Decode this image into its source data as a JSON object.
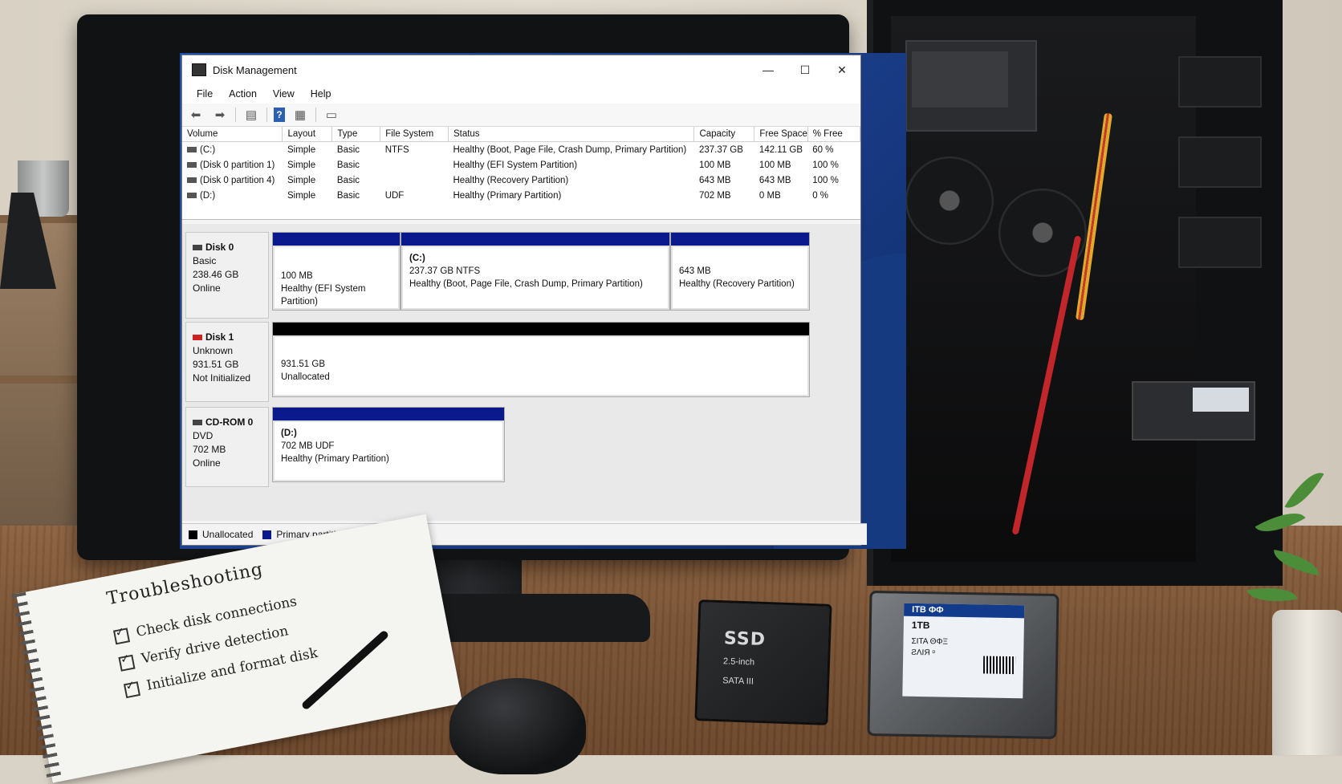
{
  "window": {
    "title": "Disk Management",
    "controls": {
      "minimize": "—",
      "maximize": "☐",
      "close": "✕"
    }
  },
  "menu": [
    "File",
    "Action",
    "View",
    "Help"
  ],
  "toolbar": {
    "back_icon": "back-arrow-icon",
    "forward_icon": "forward-arrow-icon",
    "help_label": "?"
  },
  "volume_table": {
    "columns": [
      "Volume",
      "Layout",
      "Type",
      "File System",
      "Status",
      "Capacity",
      "Free Space",
      "% Free"
    ],
    "rows": [
      [
        "(C:)",
        "Simple",
        "Basic",
        "NTFS",
        "Healthy (Boot, Page File, Crash Dump, Primary Partition)",
        "237.37 GB",
        "142.11 GB",
        "60 %"
      ],
      [
        "(Disk 0 partition 1)",
        "Simple",
        "Basic",
        "",
        "Healthy (EFI System Partition)",
        "100 MB",
        "100 MB",
        "100 %"
      ],
      [
        "(Disk 0 partition 4)",
        "Simple",
        "Basic",
        "",
        "Healthy (Recovery Partition)",
        "643 MB",
        "643 MB",
        "100 %"
      ],
      [
        "(D:)",
        "Simple",
        "Basic",
        "UDF",
        "Healthy (Primary Partition)",
        "702 MB",
        "0 MB",
        "0 %"
      ]
    ]
  },
  "disks": [
    {
      "name": "Disk 0",
      "type": "Basic",
      "size": "238.46 GB",
      "state": "Online",
      "partitions": [
        {
          "letter": "",
          "size": "100 MB",
          "status": "Healthy (EFI System Partition)"
        },
        {
          "letter": "(C:)",
          "size": "237.37 GB NTFS",
          "status": "Healthy (Boot, Page File, Crash Dump, Primary Partition)"
        },
        {
          "letter": "",
          "size": "643 MB",
          "status": "Healthy (Recovery Partition)"
        }
      ]
    },
    {
      "name": "Disk 1",
      "type": "Unknown",
      "size": "931.51 GB",
      "state": "Not Initialized",
      "partitions": [
        {
          "letter": "",
          "size": "931.51 GB",
          "status": "Unallocated"
        }
      ]
    },
    {
      "name": "CD-ROM 0",
      "type": "DVD",
      "size": "702 MB",
      "state": "Online",
      "partitions": [
        {
          "letter": "(D:)",
          "size": "702 MB UDF",
          "status": "Healthy (Primary Partition)"
        }
      ]
    }
  ],
  "legend": {
    "unallocated": "Unallocated",
    "primary": "Primary partition",
    "colors": {
      "unallocated": "#000000",
      "primary": "#0a1a8c"
    }
  },
  "notebook": {
    "title": "Troubleshooting",
    "items": [
      "Check disk connections",
      "Verify drive detection",
      "Initialize and format disk"
    ]
  },
  "ssd": {
    "title": "SSD",
    "form": "2.5-inch",
    "interface": "SATA III"
  },
  "hdd": {
    "header": "ƖTB ФФ",
    "capacity": "1TB",
    "model": "ΣITA ΘΦΞ",
    "line2": "ƧΛIЯ ᵒ"
  }
}
